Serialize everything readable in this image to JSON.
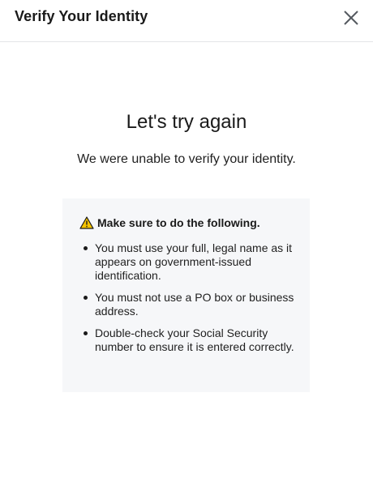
{
  "header": {
    "title": "Verify Your Identity"
  },
  "main": {
    "heading": "Let's try again",
    "message": "We were unable to verify your identity."
  },
  "panel": {
    "warning_title": "Make sure to do the following.",
    "items": [
      "You must use your full, legal name as it appears on government-issued identification.",
      "You must not use a PO box or business address.",
      "Double-check your Social Security number to ensure it is entered correctly."
    ]
  },
  "colors": {
    "warning_fill": "#f5c400",
    "panel_bg": "#f6f7f9"
  },
  "icons": {
    "close": "close-icon",
    "warning": "warning-icon"
  }
}
